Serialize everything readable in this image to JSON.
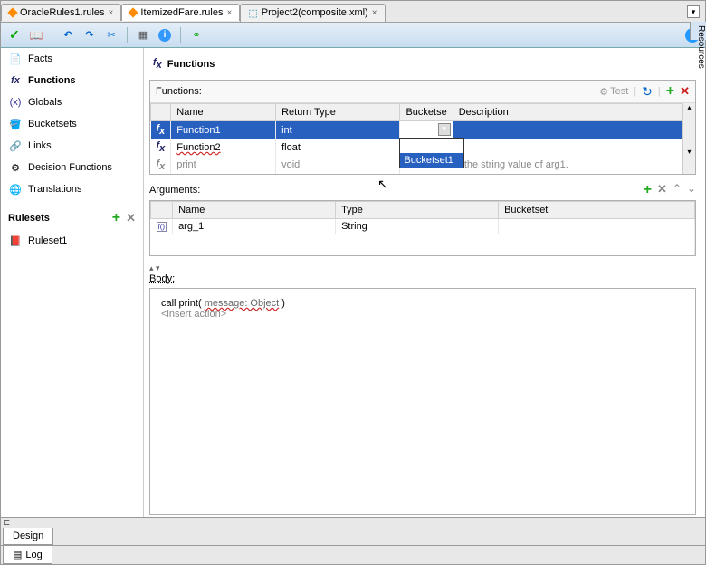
{
  "tabs": {
    "t1": "OracleRules1.rules",
    "t2": "ItemizedFare.rules",
    "t3": "Project2(composite.xml)"
  },
  "right_sidebar": "Resources",
  "sidebar": {
    "items": [
      {
        "label": "Facts",
        "icon": "facts"
      },
      {
        "label": "Functions",
        "icon": "fx"
      },
      {
        "label": "Globals",
        "icon": "globals"
      },
      {
        "label": "Bucketsets",
        "icon": "bucketsets"
      },
      {
        "label": "Links",
        "icon": "links"
      },
      {
        "label": "Decision Functions",
        "icon": "decision"
      },
      {
        "label": "Translations",
        "icon": "translations"
      }
    ],
    "rulesets_label": "Rulesets",
    "ruleset1": "Ruleset1"
  },
  "content": {
    "title": "Functions",
    "functions_panel_label": "Functions:",
    "test_label": "Test",
    "columns": {
      "name": "Name",
      "return": "Return Type",
      "bucket": "Bucketse",
      "desc": "Description"
    },
    "rows": [
      {
        "name": "Function1",
        "return": "int",
        "bucket": "",
        "desc": ""
      },
      {
        "name": "Function2",
        "return": "float",
        "bucket": "",
        "desc": ""
      },
      {
        "name": "print",
        "return": "void",
        "bucket": "",
        "desc": "t the string value of arg1."
      }
    ],
    "dropdown_item": "Bucketset1",
    "arguments_label": "Arguments:",
    "arg_columns": {
      "name": "Name",
      "type": "Type",
      "bucket": "Bucketset"
    },
    "arg_rows": [
      {
        "name": "arg_1",
        "type": "String",
        "bucket": ""
      }
    ],
    "body_label": "Body:",
    "body_line1_a": "call print(",
    "body_line1_b": "message: Object",
    "body_line1_c": ")",
    "body_line2": "<insert action>"
  },
  "bottom": {
    "design": "Design",
    "log": "Log"
  }
}
